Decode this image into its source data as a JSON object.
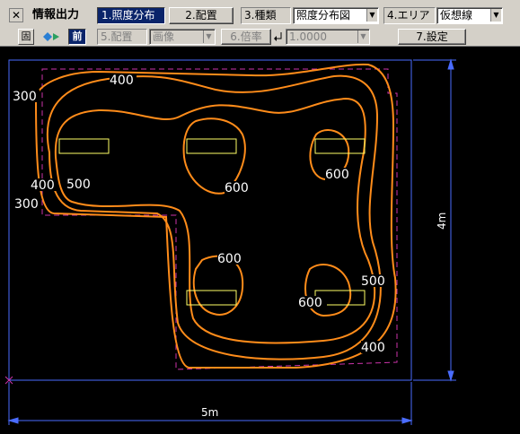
{
  "toolbar": {
    "title": "情報出力",
    "close_glyph": "✕",
    "btn_illuminance": "1.照度分布",
    "btn_layout": "2.配置",
    "type_label": "3.種類",
    "type_value": "照度分布図",
    "area_label": "4.エリア",
    "area_value": "仮想線",
    "icon_grid": "固",
    "icon_arrows": "◆▸",
    "btn_front": "前",
    "placement_label": "5.配置",
    "placement_value": "画像",
    "scale_label": "6.倍率",
    "scale_value": "1.0000",
    "btn_settings": "7.設定"
  },
  "drawing": {
    "width_label": "5m",
    "height_label": "4m",
    "contours": [
      {
        "label": "300",
        "value": 300
      },
      {
        "label": "400",
        "value": 400
      },
      {
        "label": "500",
        "value": 500
      },
      {
        "label": "600",
        "value": 600
      }
    ],
    "contour_labels": [
      "400",
      "300",
      "400",
      "500",
      "300",
      "600",
      "600",
      "600",
      "500",
      "600",
      "400"
    ],
    "luminaire_count": 5,
    "colors": {
      "background": "#000000",
      "contour": "#ff8c1a",
      "luminaire": "#ffff66",
      "area_dashed": "#cc33aa",
      "dimension": "#4a6cff",
      "text": "#ffffff"
    }
  }
}
